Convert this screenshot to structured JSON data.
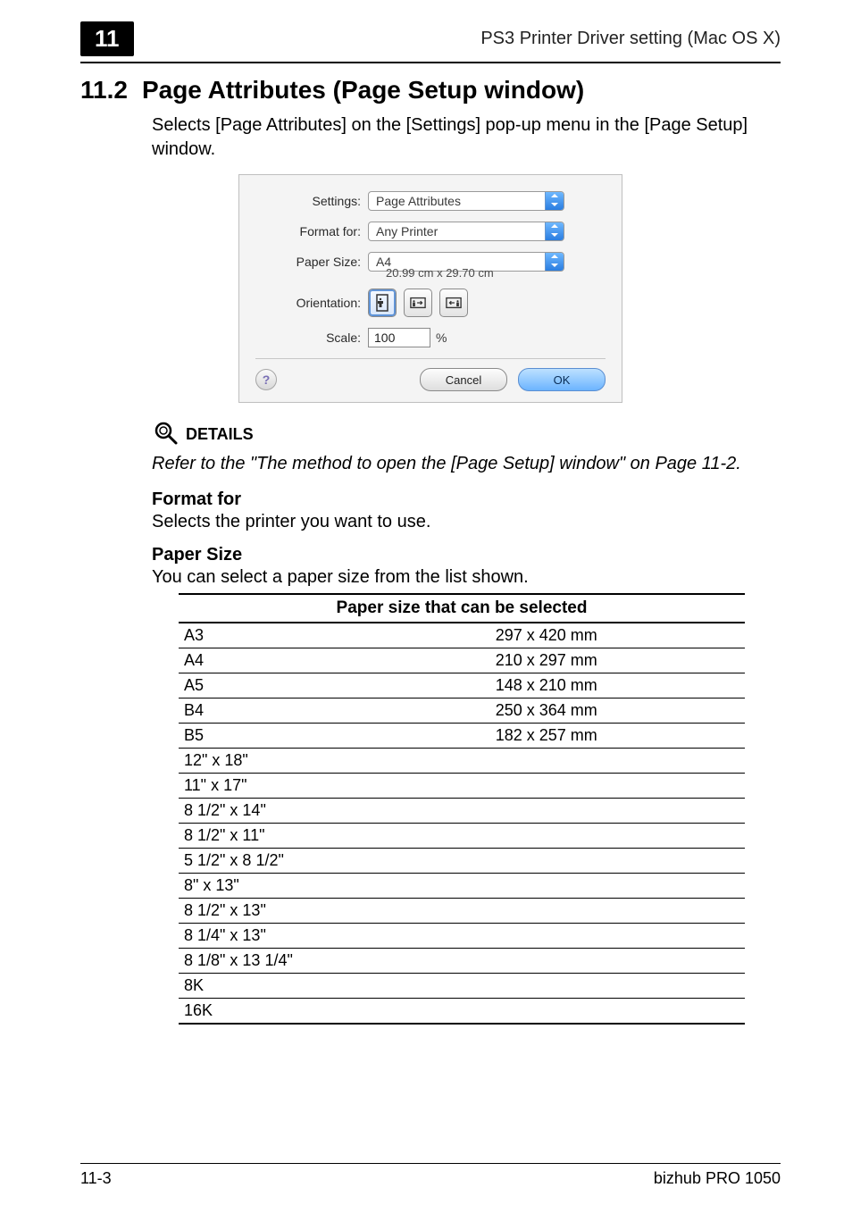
{
  "header": {
    "chapter_number": "11",
    "section_title": "PS3 Printer Driver setting (Mac OS X)"
  },
  "section": {
    "number": "11.2",
    "title": "Page Attributes (Page Setup window)",
    "intro": "Selects [Page Attributes] on the [Settings] pop-up menu in the [Page Setup] window."
  },
  "dialog": {
    "labels": {
      "settings": "Settings:",
      "format_for": "Format for:",
      "paper_size": "Paper Size:",
      "orientation": "Orientation:",
      "scale": "Scale:"
    },
    "values": {
      "settings": "Page Attributes",
      "format_for": "Any Printer",
      "paper_size": "A4",
      "paper_dim": "20.99 cm x 29.70 cm",
      "scale": "100",
      "scale_unit": "%"
    },
    "buttons": {
      "help": "?",
      "cancel": "Cancel",
      "ok": "OK"
    }
  },
  "details": {
    "heading": "DETAILS",
    "text": "Refer to the \"The method to open the [Page Setup] window\" on Page 11-2."
  },
  "format_for": {
    "heading": "Format for",
    "body": "Selects the printer you want to use."
  },
  "paper_size": {
    "heading": "Paper Size",
    "intro": "You can select a paper size from the list shown.",
    "table_header": "Paper size that can be selected",
    "rows": [
      {
        "name": "A3",
        "dim": "297 x 420 mm"
      },
      {
        "name": "A4",
        "dim": "210 x 297 mm"
      },
      {
        "name": "A5",
        "dim": "148 x 210 mm"
      },
      {
        "name": "B4",
        "dim": "250 x 364 mm"
      },
      {
        "name": "B5",
        "dim": "182 x 257 mm"
      },
      {
        "name": "12\" x 18\"",
        "dim": ""
      },
      {
        "name": "11\" x 17\"",
        "dim": ""
      },
      {
        "name": "8 1/2\" x 14\"",
        "dim": ""
      },
      {
        "name": "8 1/2\" x 11\"",
        "dim": ""
      },
      {
        "name": "5 1/2\" x 8 1/2\"",
        "dim": ""
      },
      {
        "name": "8\" x 13\"",
        "dim": ""
      },
      {
        "name": "8 1/2\" x 13\"",
        "dim": ""
      },
      {
        "name": "8 1/4\" x 13\"",
        "dim": ""
      },
      {
        "name": "8 1/8\" x 13 1/4\"",
        "dim": ""
      },
      {
        "name": "8K",
        "dim": ""
      },
      {
        "name": "16K",
        "dim": ""
      }
    ]
  },
  "footer": {
    "page": "11-3",
    "product": "bizhub PRO 1050"
  }
}
